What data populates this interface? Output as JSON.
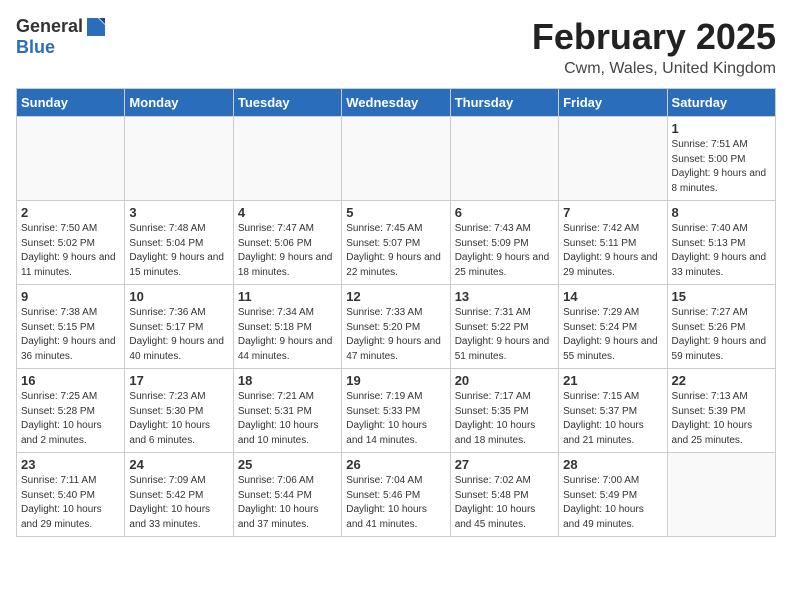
{
  "header": {
    "logo": {
      "general": "General",
      "blue": "Blue"
    },
    "title": "February 2025",
    "subtitle": "Cwm, Wales, United Kingdom"
  },
  "weekdays": [
    "Sunday",
    "Monday",
    "Tuesday",
    "Wednesday",
    "Thursday",
    "Friday",
    "Saturday"
  ],
  "weeks": [
    [
      {
        "day": "",
        "info": ""
      },
      {
        "day": "",
        "info": ""
      },
      {
        "day": "",
        "info": ""
      },
      {
        "day": "",
        "info": ""
      },
      {
        "day": "",
        "info": ""
      },
      {
        "day": "",
        "info": ""
      },
      {
        "day": "1",
        "info": "Sunrise: 7:51 AM\nSunset: 5:00 PM\nDaylight: 9 hours and 8 minutes."
      }
    ],
    [
      {
        "day": "2",
        "info": "Sunrise: 7:50 AM\nSunset: 5:02 PM\nDaylight: 9 hours and 11 minutes."
      },
      {
        "day": "3",
        "info": "Sunrise: 7:48 AM\nSunset: 5:04 PM\nDaylight: 9 hours and 15 minutes."
      },
      {
        "day": "4",
        "info": "Sunrise: 7:47 AM\nSunset: 5:06 PM\nDaylight: 9 hours and 18 minutes."
      },
      {
        "day": "5",
        "info": "Sunrise: 7:45 AM\nSunset: 5:07 PM\nDaylight: 9 hours and 22 minutes."
      },
      {
        "day": "6",
        "info": "Sunrise: 7:43 AM\nSunset: 5:09 PM\nDaylight: 9 hours and 25 minutes."
      },
      {
        "day": "7",
        "info": "Sunrise: 7:42 AM\nSunset: 5:11 PM\nDaylight: 9 hours and 29 minutes."
      },
      {
        "day": "8",
        "info": "Sunrise: 7:40 AM\nSunset: 5:13 PM\nDaylight: 9 hours and 33 minutes."
      }
    ],
    [
      {
        "day": "9",
        "info": "Sunrise: 7:38 AM\nSunset: 5:15 PM\nDaylight: 9 hours and 36 minutes."
      },
      {
        "day": "10",
        "info": "Sunrise: 7:36 AM\nSunset: 5:17 PM\nDaylight: 9 hours and 40 minutes."
      },
      {
        "day": "11",
        "info": "Sunrise: 7:34 AM\nSunset: 5:18 PM\nDaylight: 9 hours and 44 minutes."
      },
      {
        "day": "12",
        "info": "Sunrise: 7:33 AM\nSunset: 5:20 PM\nDaylight: 9 hours and 47 minutes."
      },
      {
        "day": "13",
        "info": "Sunrise: 7:31 AM\nSunset: 5:22 PM\nDaylight: 9 hours and 51 minutes."
      },
      {
        "day": "14",
        "info": "Sunrise: 7:29 AM\nSunset: 5:24 PM\nDaylight: 9 hours and 55 minutes."
      },
      {
        "day": "15",
        "info": "Sunrise: 7:27 AM\nSunset: 5:26 PM\nDaylight: 9 hours and 59 minutes."
      }
    ],
    [
      {
        "day": "16",
        "info": "Sunrise: 7:25 AM\nSunset: 5:28 PM\nDaylight: 10 hours and 2 minutes."
      },
      {
        "day": "17",
        "info": "Sunrise: 7:23 AM\nSunset: 5:30 PM\nDaylight: 10 hours and 6 minutes."
      },
      {
        "day": "18",
        "info": "Sunrise: 7:21 AM\nSunset: 5:31 PM\nDaylight: 10 hours and 10 minutes."
      },
      {
        "day": "19",
        "info": "Sunrise: 7:19 AM\nSunset: 5:33 PM\nDaylight: 10 hours and 14 minutes."
      },
      {
        "day": "20",
        "info": "Sunrise: 7:17 AM\nSunset: 5:35 PM\nDaylight: 10 hours and 18 minutes."
      },
      {
        "day": "21",
        "info": "Sunrise: 7:15 AM\nSunset: 5:37 PM\nDaylight: 10 hours and 21 minutes."
      },
      {
        "day": "22",
        "info": "Sunrise: 7:13 AM\nSunset: 5:39 PM\nDaylight: 10 hours and 25 minutes."
      }
    ],
    [
      {
        "day": "23",
        "info": "Sunrise: 7:11 AM\nSunset: 5:40 PM\nDaylight: 10 hours and 29 minutes."
      },
      {
        "day": "24",
        "info": "Sunrise: 7:09 AM\nSunset: 5:42 PM\nDaylight: 10 hours and 33 minutes."
      },
      {
        "day": "25",
        "info": "Sunrise: 7:06 AM\nSunset: 5:44 PM\nDaylight: 10 hours and 37 minutes."
      },
      {
        "day": "26",
        "info": "Sunrise: 7:04 AM\nSunset: 5:46 PM\nDaylight: 10 hours and 41 minutes."
      },
      {
        "day": "27",
        "info": "Sunrise: 7:02 AM\nSunset: 5:48 PM\nDaylight: 10 hours and 45 minutes."
      },
      {
        "day": "28",
        "info": "Sunrise: 7:00 AM\nSunset: 5:49 PM\nDaylight: 10 hours and 49 minutes."
      },
      {
        "day": "",
        "info": ""
      }
    ]
  ]
}
